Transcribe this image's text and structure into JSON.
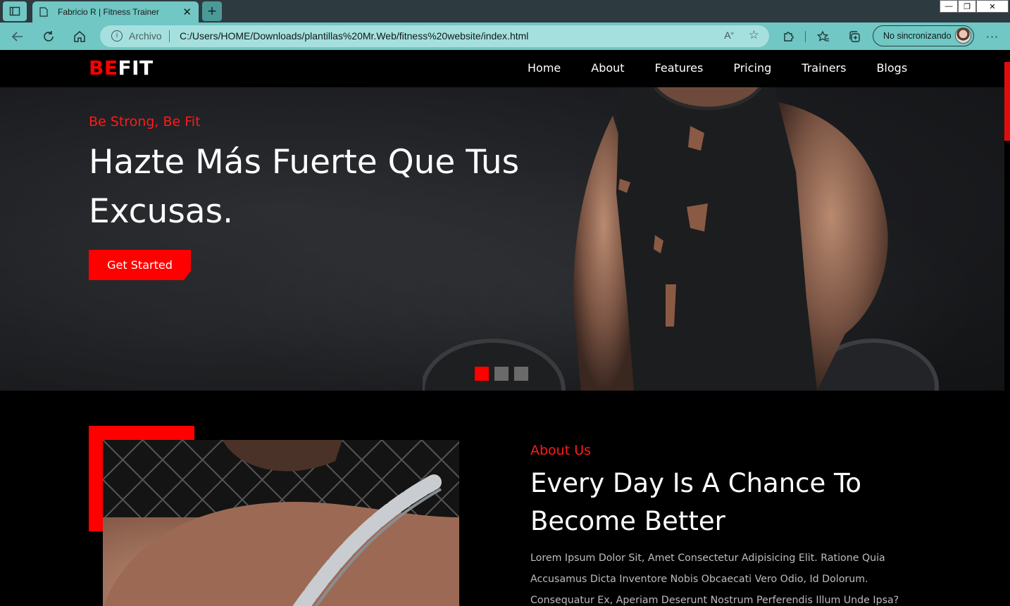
{
  "browser": {
    "tab_title": "Fabricio R | Fitness Trainer",
    "tab_close": "✕",
    "new_tab": "+",
    "address_scheme": "Archivo",
    "address_url": "C:/Users/HOME/Downloads/plantillas%20Mr.Web/fitness%20website/index.html",
    "profile_label": "No sincronizando",
    "window_minimize": "—",
    "window_restore": "❐",
    "window_close": "✕"
  },
  "site": {
    "logo_be": "BE",
    "logo_fit": "FIT",
    "nav": [
      "Home",
      "About",
      "Features",
      "Pricing",
      "Trainers",
      "Blogs"
    ],
    "hero": {
      "subtitle": "Be Strong, Be Fit",
      "title": "Hazte Más Fuerte Que Tus Excusas.",
      "cta": "Get Started",
      "slides": 3,
      "active_slide": 1
    },
    "about": {
      "label": "About Us",
      "title": "Every Day Is A Chance To Become Better",
      "text": "Lorem Ipsum Dolor Sit, Amet Consectetur Adipisicing Elit. Ratione Quia Accusamus Dicta Inventore Nobis Obcaecati Vero Odio, Id Dolorum. Consequatur Ex, Aperiam Deserunt Nostrum Perferendis Illum Unde Ipsa? Consequatur,"
    }
  },
  "colors": {
    "accent": "#ff0000",
    "browser_accent": "#70c7c4",
    "page_background": "#000000"
  }
}
